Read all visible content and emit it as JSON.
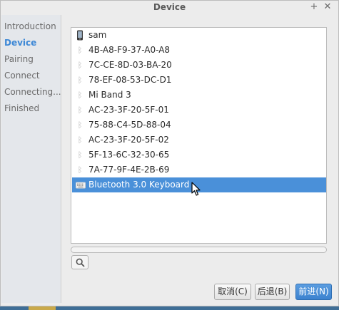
{
  "window": {
    "title": "Device",
    "plus_glyph": "+",
    "close_glyph": "✕"
  },
  "sidebar": {
    "steps": [
      {
        "label": "Introduction",
        "active": false
      },
      {
        "label": "Device",
        "active": true
      },
      {
        "label": "Pairing",
        "active": false
      },
      {
        "label": "Connect",
        "active": false
      },
      {
        "label": "Connecting...",
        "active": false
      },
      {
        "label": "Finished",
        "active": false
      }
    ]
  },
  "device_list": {
    "items": [
      {
        "name": "sam",
        "icon": "phone-icon",
        "selected": false
      },
      {
        "name": "4B-A8-F9-37-A0-A8",
        "icon": "bluetooth-icon",
        "selected": false
      },
      {
        "name": "7C-CE-8D-03-BA-20",
        "icon": "bluetooth-icon",
        "selected": false
      },
      {
        "name": "78-EF-08-53-DC-D1",
        "icon": "bluetooth-icon",
        "selected": false
      },
      {
        "name": "Mi Band 3",
        "icon": "bluetooth-icon",
        "selected": false
      },
      {
        "name": "AC-23-3F-20-5F-01",
        "icon": "bluetooth-icon",
        "selected": false
      },
      {
        "name": "75-88-C4-5D-88-04",
        "icon": "bluetooth-icon",
        "selected": false
      },
      {
        "name": "AC-23-3F-20-5F-02",
        "icon": "bluetooth-icon",
        "selected": false
      },
      {
        "name": "5F-13-6C-32-30-65",
        "icon": "bluetooth-icon",
        "selected": false
      },
      {
        "name": "7A-77-9F-4E-2B-69",
        "icon": "bluetooth-icon",
        "selected": false
      },
      {
        "name": "Bluetooth 3.0 Keyboard",
        "icon": "keyboard-icon",
        "selected": true
      }
    ]
  },
  "buttons": {
    "cancel": "取消(C)",
    "back": "后退(B)",
    "next": "前进(N)"
  },
  "colors": {
    "accent": "#4a90d9",
    "active_step": "#3d88d6"
  }
}
